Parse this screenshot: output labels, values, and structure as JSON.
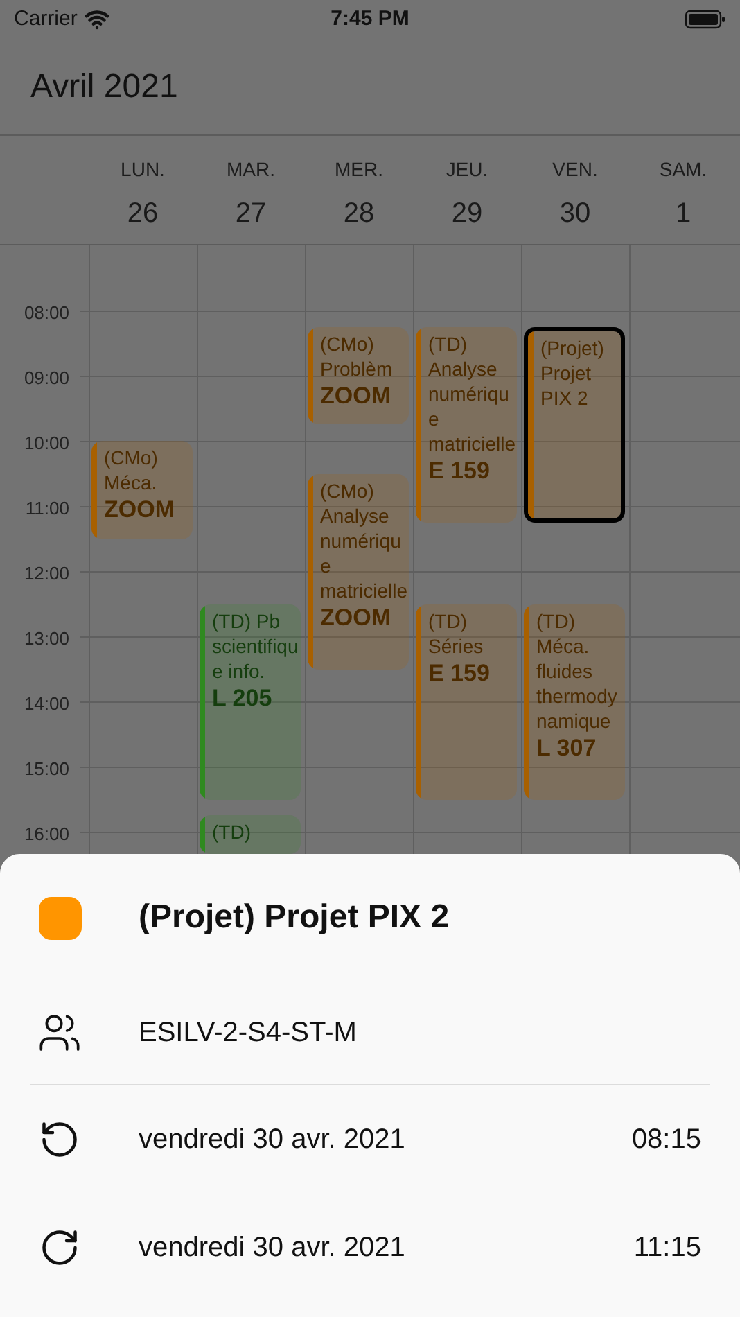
{
  "status_bar": {
    "carrier": "Carrier",
    "time": "7:45 PM"
  },
  "month_title": "Avril 2021",
  "hours": [
    "08:00",
    "09:00",
    "10:00",
    "11:00",
    "12:00",
    "13:00",
    "14:00",
    "15:00",
    "16:00"
  ],
  "days": [
    {
      "weekday": "LUN.",
      "date": "26",
      "events": [
        {
          "title": "(CMo) Méca.",
          "room": "ZOOM",
          "color": "#a86000",
          "selected": false
        }
      ]
    },
    {
      "weekday": "MAR.",
      "date": "27",
      "events": [
        {
          "title": "(TD) Pb scientifique info.",
          "room": "L 205",
          "color": "#2f8a1f",
          "selected": false
        },
        {
          "title": "(TD)",
          "color": "#2f8a1f",
          "selected": false
        }
      ]
    },
    {
      "weekday": "MER.",
      "date": "28",
      "events": [
        {
          "title": "(CMo) Problèm",
          "room": "ZOOM",
          "color": "#a86000",
          "selected": false
        },
        {
          "title": "(CMo) Analyse numérique matricielle",
          "room": "ZOOM",
          "color": "#a86000",
          "selected": false
        }
      ]
    },
    {
      "weekday": "JEU.",
      "date": "29",
      "events": [
        {
          "title": "(TD) Analyse numérique matricielle",
          "room": "E 159",
          "color": "#a86000",
          "selected": false
        },
        {
          "title": "(TD) Séries",
          "room": "E 159",
          "color": "#a86000",
          "selected": false
        }
      ]
    },
    {
      "weekday": "VEN.",
      "date": "30",
      "events": [
        {
          "title": "(Projet) Projet PIX 2",
          "color": "#a86000",
          "selected": true
        },
        {
          "title": "(TD) Méca. fluides thermodynamique",
          "room": "L 307",
          "color": "#a86000",
          "selected": false
        }
      ]
    },
    {
      "weekday": "SAM.",
      "date": "1"
    }
  ],
  "detail": {
    "color": "#ff9500",
    "title": "(Projet) Projet PIX 2",
    "group": "ESILV-2-S4-ST-M",
    "rows": [
      {
        "kind": "start",
        "date": "vendredi 30 avr. 2021",
        "time": "08:15"
      },
      {
        "kind": "end",
        "date": "vendredi 30 avr. 2021",
        "time": "11:15"
      }
    ]
  }
}
